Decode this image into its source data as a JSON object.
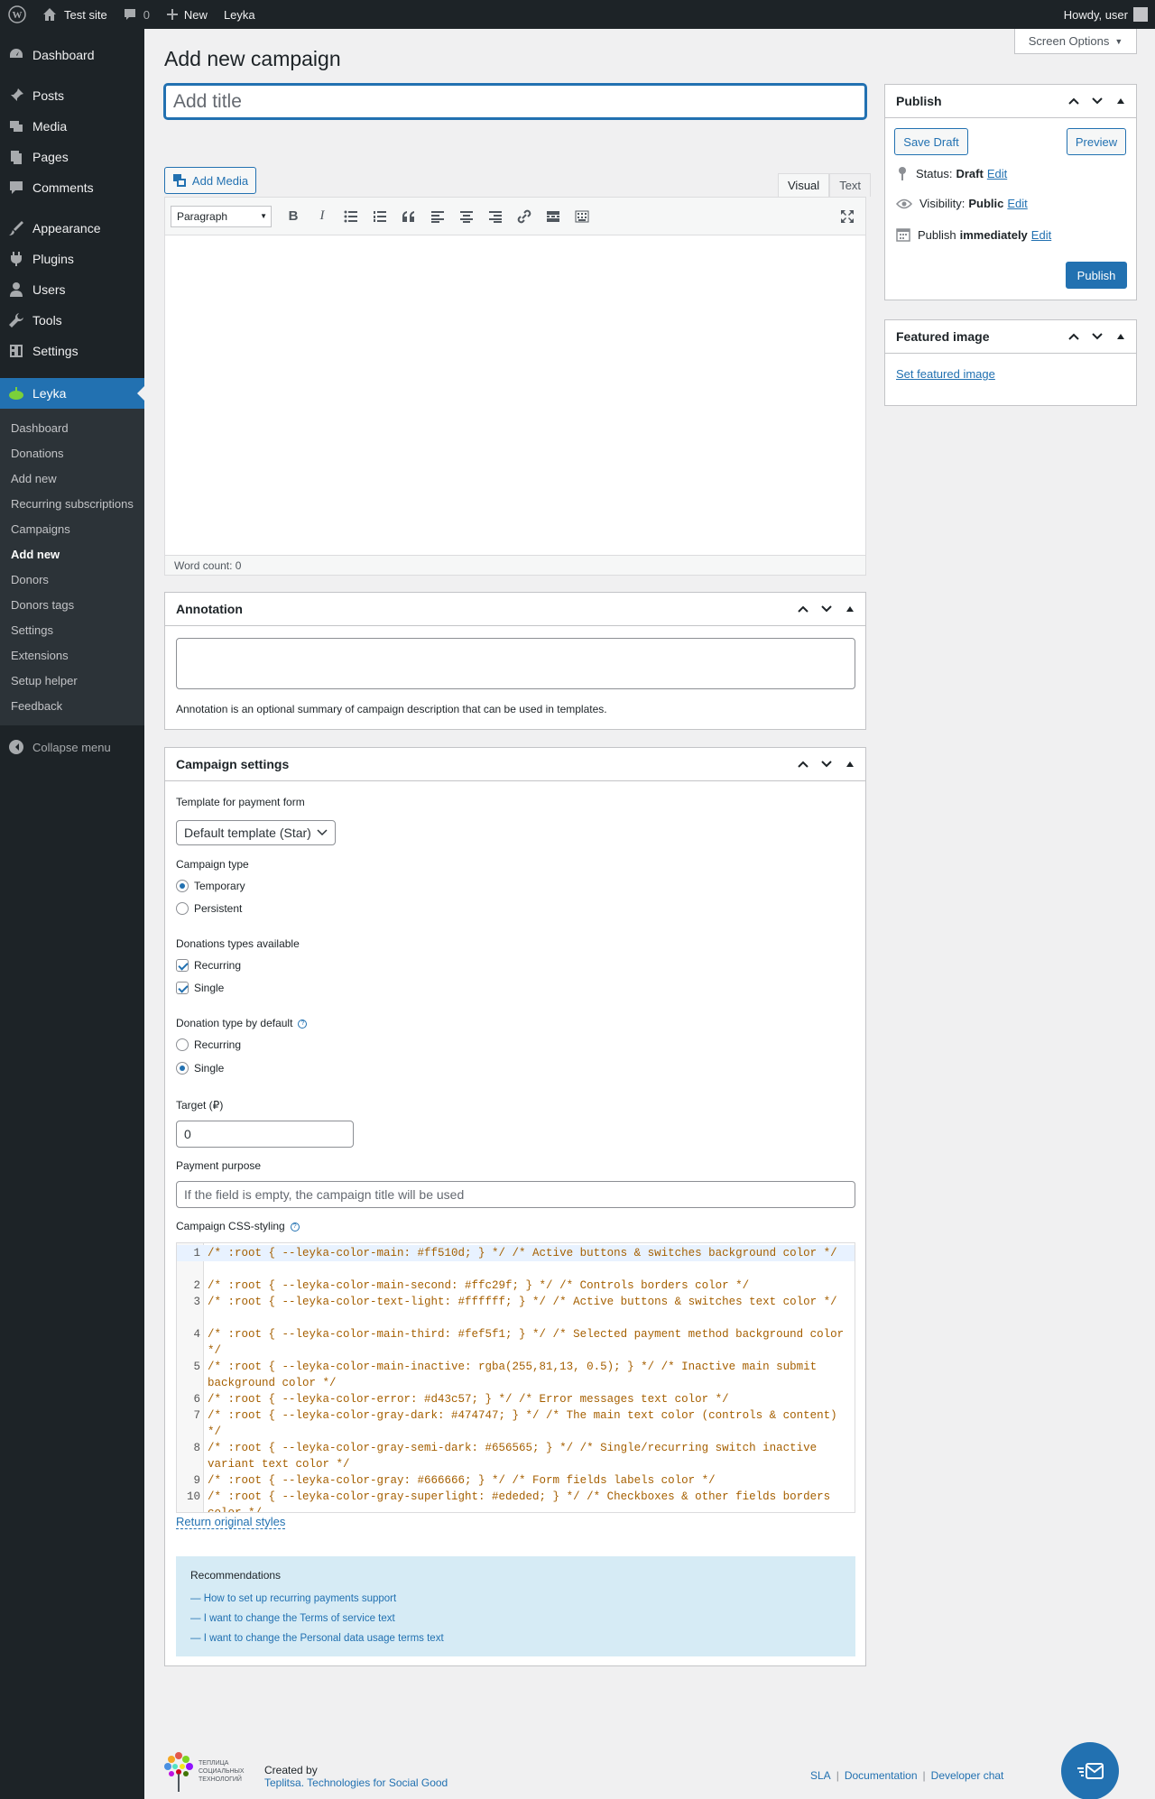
{
  "adminbar": {
    "site_name": "Test site",
    "comments_count": "0",
    "new_label": "New",
    "plugin_label": "Leyka",
    "howdy": "Howdy, user"
  },
  "sidebar": {
    "items": [
      {
        "label": "Dashboard",
        "icon": "dashboard-icon"
      },
      {
        "label": "Posts",
        "icon": "pin-icon"
      },
      {
        "label": "Media",
        "icon": "media-icon"
      },
      {
        "label": "Pages",
        "icon": "pages-icon"
      },
      {
        "label": "Comments",
        "icon": "comments-icon"
      },
      {
        "label": "Appearance",
        "icon": "brush-icon"
      },
      {
        "label": "Plugins",
        "icon": "plugin-icon"
      },
      {
        "label": "Users",
        "icon": "users-icon"
      },
      {
        "label": "Tools",
        "icon": "wrench-icon"
      },
      {
        "label": "Settings",
        "icon": "settings-icon"
      },
      {
        "label": "Leyka",
        "icon": "leyka-icon"
      }
    ],
    "submenu": [
      "Dashboard",
      "Donations",
      "Add new",
      "Recurring subscriptions",
      "Campaigns",
      "Add new",
      "Donors",
      "Donors tags",
      "Settings",
      "Extensions",
      "Setup helper",
      "Feedback"
    ],
    "collapse": "Collapse menu"
  },
  "screen_options": "Screen Options",
  "page_title": "Add new campaign",
  "title_placeholder": "Add title",
  "editor": {
    "add_media": "Add Media",
    "tab_visual": "Visual",
    "tab_text": "Text",
    "format": "Paragraph",
    "word_count": "Word count: 0"
  },
  "annotation": {
    "title": "Annotation",
    "hint": "Annotation is an optional summary of campaign description that can be used in templates."
  },
  "settings": {
    "title": "Campaign settings",
    "template_label": "Template for payment form",
    "template_value": "Default template (Star)",
    "campaign_type_label": "Campaign type",
    "campaign_types": [
      "Temporary",
      "Persistent"
    ],
    "donation_types_label": "Donations types available",
    "donation_types": [
      "Recurring",
      "Single"
    ],
    "default_type_label": "Donation type by default",
    "default_types": [
      "Recurring",
      "Single"
    ],
    "target_label": "Target (₽)",
    "target_value": "0",
    "purpose_label": "Payment purpose",
    "purpose_placeholder": "If the field is empty, the campaign title will be used",
    "css_label": "Campaign CSS-styling",
    "css_lines": [
      {
        "n": "1",
        "text": "/* :root { --leyka-color-main: #ff510d; } */ /* Active buttons & switches background color */"
      },
      {
        "n": "2",
        "text": "/* :root { --leyka-color-main-second: #ffc29f; } */ /* Controls borders color */"
      },
      {
        "n": "3",
        "text": "/* :root { --leyka-color-text-light: #ffffff; } */ /* Active buttons & switches text color */"
      },
      {
        "n": "4",
        "text": "/* :root { --leyka-color-main-third: #fef5f1; } */ /* Selected payment method background color */"
      },
      {
        "n": "5",
        "text": "/* :root { --leyka-color-main-inactive: rgba(255,81,13, 0.5); } */ /* Inactive main submit background color */"
      },
      {
        "n": "6",
        "text": "/* :root { --leyka-color-error: #d43c57; } */ /* Error messages text color */"
      },
      {
        "n": "7",
        "text": "/* :root { --leyka-color-gray-dark: #474747; } */ /* The main text color (controls & content) */"
      },
      {
        "n": "8",
        "text": "/* :root { --leyka-color-gray-semi-dark: #656565; } */ /* Single/recurring switch inactive variant text color */"
      },
      {
        "n": "9",
        "text": "/* :root { --leyka-color-gray: #666666; } */ /* Form fields labels color */"
      },
      {
        "n": "10",
        "text": "/* :root { --leyka-color-gray-superlight: #ededed; } */ /* Checkboxes & other fields borders color */"
      }
    ],
    "return_link": "Return original styles",
    "recommend_title": "Recommendations",
    "recommend_links": [
      "— How to set up recurring payments support",
      "— I want to change the Terms of service text",
      "— I want to change the Personal data usage terms text"
    ]
  },
  "publish": {
    "title": "Publish",
    "save_draft": "Save Draft",
    "preview": "Preview",
    "status_label": "Status:",
    "status_value": "Draft",
    "visibility_label": "Visibility:",
    "visibility_value": "Public",
    "publish_label": "Publish",
    "publish_value": "immediately",
    "edit": "Edit",
    "publish_btn": "Publish"
  },
  "featured": {
    "title": "Featured image",
    "link": "Set featured image"
  },
  "footer": {
    "logo_text": "ТЕПЛИЦА СОЦИАЛЬНЫХ ТЕХНОЛОГИЙ",
    "created_by": "Created by",
    "org": "Teplitsa. Technologies for Social Good",
    "links": [
      "SLA",
      "Documentation",
      "Developer chat"
    ]
  },
  "colors": {
    "accent": "#2271b1",
    "sidebar": "#1d2327",
    "code": "#a55f00"
  }
}
